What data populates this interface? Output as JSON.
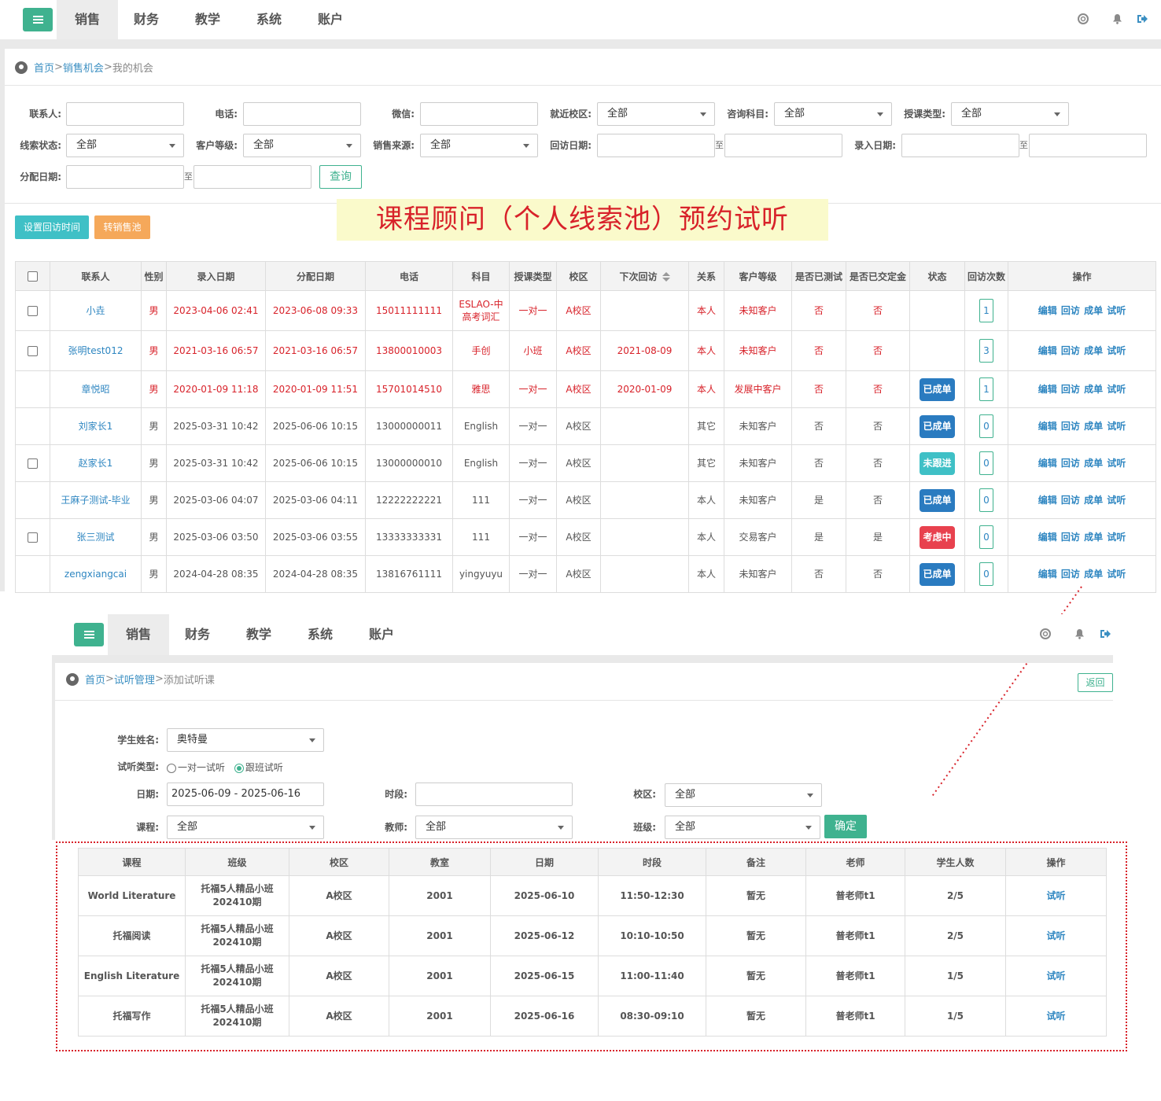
{
  "top": {
    "tabs": [
      "销售",
      "财务",
      "教学",
      "系统",
      "账户"
    ],
    "breadcrumb": {
      "home": "首页",
      "sep1": " > ",
      "section": "销售机会",
      "sep2": "> ",
      "current": "我的机会"
    }
  },
  "filters": {
    "contact_label": "联系人:",
    "phone_label": "电话:",
    "wechat_label": "微信:",
    "campus_label": "就近校区:",
    "campus_value": "全部",
    "subject_label": "咨询科目:",
    "subject_value": "全部",
    "teach_type_label": "授课类型:",
    "teach_type_value": "全部",
    "lead_status_label": "线索状态:",
    "lead_status_value": "全部",
    "level_label": "客户等级:",
    "level_value": "全部",
    "source_label": "销售来源:",
    "source_value": "全部",
    "visit_date_label": "回访日期:",
    "entry_date_label": "录入日期:",
    "assign_date_label": "分配日期:",
    "to": "至",
    "query_button": "查询"
  },
  "actions": {
    "set_visit": "设置回访时间",
    "transfer": "转销售池"
  },
  "banner": "课程顾问（个人线索池）预约试听",
  "table1": {
    "headers": [
      "联系人",
      "性别",
      "录入日期",
      "分配日期",
      "电话",
      "科目",
      "授课类型",
      "校区",
      "下次回访",
      "关系",
      "客户等级",
      "是否已测试",
      "是否已交定金",
      "状态",
      "回访次数",
      "操作"
    ],
    "rows": [
      {
        "name": "小垚",
        "gender": "男",
        "entry": "2023-04-06 02:41",
        "assign": "2023-06-08 09:33",
        "phone": "15011111111",
        "subject": "ESLAO-中高考词汇",
        "type": "一对一",
        "campus": "A校区",
        "next": "",
        "rel": "本人",
        "level": "未知客户",
        "tested": "否",
        "deposit": "否",
        "status": "",
        "visits": "1"
      },
      {
        "name": "张明test012",
        "gender": "男",
        "entry": "2021-03-16 06:57",
        "assign": "2021-03-16 06:57",
        "phone": "13800010003",
        "subject": "手创",
        "type": "小班",
        "campus": "A校区",
        "next": "2021-08-09",
        "rel": "本人",
        "level": "未知客户",
        "tested": "否",
        "deposit": "否",
        "status": "",
        "visits": "3"
      },
      {
        "name": "章悦昭",
        "gender": "男",
        "entry": "2020-01-09 11:18",
        "assign": "2020-01-09 11:51",
        "phone": "15701014510",
        "subject": "雅思",
        "type": "一对一",
        "campus": "A校区",
        "next": "2020-01-09",
        "rel": "本人",
        "level": "发展中客户",
        "tested": "否",
        "deposit": "否",
        "status": "已成单",
        "visits": "1"
      },
      {
        "name": "刘家长1",
        "gender": "男",
        "entry": "2025-03-31 10:42",
        "assign": "2025-06-06 10:15",
        "phone": "13000000011",
        "subject": "English",
        "type": "一对一",
        "campus": "A校区",
        "next": "",
        "rel": "其它",
        "level": "未知客户",
        "tested": "否",
        "deposit": "否",
        "status": "已成单",
        "visits": "0"
      },
      {
        "name": "赵家长1",
        "gender": "男",
        "entry": "2025-03-31 10:42",
        "assign": "2025-06-06 10:15",
        "phone": "13000000010",
        "subject": "English",
        "type": "一对一",
        "campus": "A校区",
        "next": "",
        "rel": "其它",
        "level": "未知客户",
        "tested": "否",
        "deposit": "否",
        "status": "未跟进",
        "visits": "0"
      },
      {
        "name": "王麻子测试-毕业",
        "gender": "男",
        "entry": "2025-03-06 04:07",
        "assign": "2025-03-06 04:11",
        "phone": "12222222221",
        "subject": "111",
        "type": "一对一",
        "campus": "A校区",
        "next": "",
        "rel": "本人",
        "level": "未知客户",
        "tested": "是",
        "deposit": "否",
        "status": "已成单",
        "visits": "0"
      },
      {
        "name": "张三测试",
        "gender": "男",
        "entry": "2025-03-06 03:50",
        "assign": "2025-03-06 03:55",
        "phone": "13333333331",
        "subject": "111",
        "type": "一对一",
        "campus": "A校区",
        "next": "",
        "rel": "本人",
        "level": "交易客户",
        "tested": "是",
        "deposit": "是",
        "status": "考虑中",
        "visits": "0"
      },
      {
        "name": "zengxiangcai",
        "gender": "男",
        "entry": "2024-04-28 08:35",
        "assign": "2024-04-28 08:35",
        "phone": "13816761111",
        "subject": "yingyuyu",
        "type": "一对一",
        "campus": "A校区",
        "next": "",
        "rel": "本人",
        "level": "未知客户",
        "tested": "否",
        "deposit": "否",
        "status": "已成单",
        "visits": "0"
      }
    ],
    "ops": "编辑 回访 成单 试听"
  },
  "second": {
    "tabs": [
      "销售",
      "财务",
      "教学",
      "系统",
      "账户"
    ],
    "breadcrumb": {
      "home": "首页",
      "sep1": "> ",
      "section": "试听管理",
      "sep2": ">",
      "current": "添加试听课"
    },
    "back": "返回",
    "student_label": "学生姓名:",
    "student_value": "奥特曼",
    "trial_type_label": "试听类型:",
    "trial_opt1": "一对一试听",
    "trial_opt2": "跟班试听",
    "date_label": "日期:",
    "date_value": "2025-06-09 - 2025-06-16",
    "period_label": "时段:",
    "campus_label": "校区:",
    "campus_value": "全部",
    "course_label": "课程:",
    "course_value": "全部",
    "teacher_label": "教师:",
    "teacher_value": "全部",
    "class_label": "班级:",
    "class_value": "全部",
    "confirm": "确定"
  },
  "table2": {
    "headers": [
      "课程",
      "班级",
      "校区",
      "教室",
      "日期",
      "时段",
      "备注",
      "老师",
      "学生人数",
      "操作"
    ],
    "rows": [
      {
        "course": "World Literature",
        "cls1": "托福5人精品小班",
        "cls2": "202410期",
        "campus": "A校区",
        "room": "2001",
        "date": "2025-06-10",
        "time": "11:50-12:30",
        "note": "暂无",
        "teacher": "普老师t1",
        "count": "2/5",
        "op": "试听"
      },
      {
        "course": "托福阅读",
        "cls1": "托福5人精品小班",
        "cls2": "202410期",
        "campus": "A校区",
        "room": "2001",
        "date": "2025-06-12",
        "time": "10:10-10:50",
        "note": "暂无",
        "teacher": "普老师t1",
        "count": "2/5",
        "op": "试听"
      },
      {
        "course": "English Literature",
        "cls1": "托福5人精品小班",
        "cls2": "202410期",
        "campus": "A校区",
        "room": "2001",
        "date": "2025-06-15",
        "time": "11:00-11:40",
        "note": "暂无",
        "teacher": "普老师t1",
        "count": "1/5",
        "op": "试听"
      },
      {
        "course": "托福写作",
        "cls1": "托福5人精品小班",
        "cls2": "202410期",
        "campus": "A校区",
        "room": "2001",
        "date": "2025-06-16",
        "time": "08:30-09:10",
        "note": "暂无",
        "teacher": "普老师t1",
        "count": "1/5",
        "op": "试听"
      }
    ]
  },
  "colors": {
    "accent": "#3fb28f",
    "link": "#2e86c1",
    "red": "#d8222a",
    "orange": "#f5a85a",
    "teal": "#3fc0c6",
    "blue": "#2a7bc0",
    "pink": "#e8414e"
  }
}
